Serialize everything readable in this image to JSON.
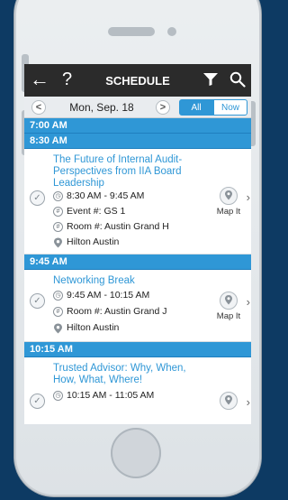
{
  "topbar": {
    "title": "SCHEDULE",
    "back_icon": "back-arrow-icon",
    "help_label": "?"
  },
  "datebar": {
    "prev": "<",
    "date": "Mon, Sep. 18",
    "next": ">",
    "filter_all": "All",
    "filter_now": "Now"
  },
  "schedule": {
    "hdr_700": "7:00 AM",
    "hdr_830": "8:30 AM",
    "session1": {
      "title": "The Future of Internal Audit-Perspectives from IIA Board Leadership",
      "time": "8:30 AM - 9:45 AM",
      "event": "Event #: GS 1",
      "room": "Room #: Austin Grand H",
      "location": "Hilton Austin",
      "map_label": "Map It"
    },
    "hdr_945": "9:45 AM",
    "session2": {
      "title": "Networking Break",
      "time": "9:45 AM - 10:15 AM",
      "room": "Room #: Austin Grand J",
      "location": "Hilton Austin",
      "map_label": "Map It"
    },
    "hdr_1015": "10:15 AM",
    "session3": {
      "title": "Trusted Advisor: Why, When, How, What, Where!",
      "time": "10:15 AM - 11:05 AM"
    }
  },
  "colors": {
    "accent": "#2f97d6",
    "background": "#0d3a63",
    "topbar": "#2b2b2b"
  }
}
